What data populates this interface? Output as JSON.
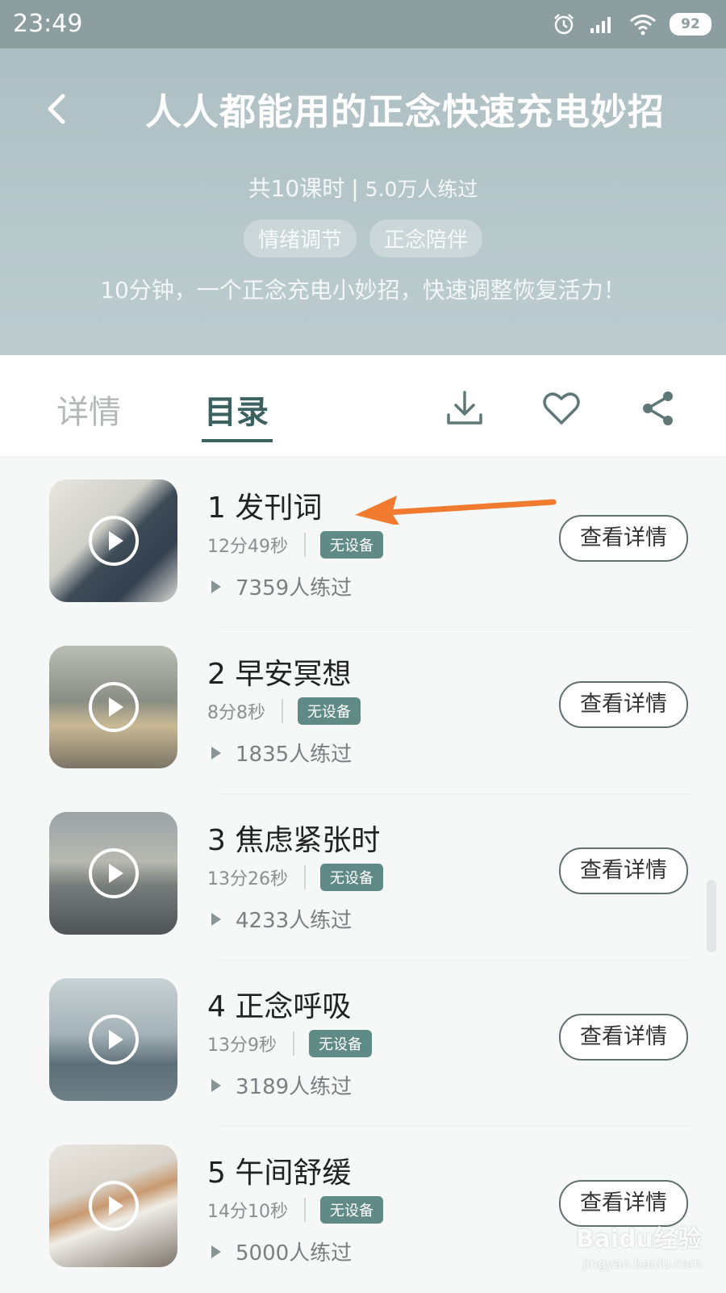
{
  "status_bar": {
    "time": "23:49",
    "battery": "92"
  },
  "header": {
    "title": "人人都能用的正念快速充电妙招",
    "lessons": "共10课时",
    "separator": "|",
    "practiced": "5.0万人练过",
    "tags": [
      "情绪调节",
      "正念陪伴"
    ],
    "description": "10分钟，一个正念充电小妙招，快速调整恢复活力！"
  },
  "tabs": {
    "detail": "详情",
    "catalog": "目录"
  },
  "lessons": [
    {
      "title": "1 发刊词",
      "duration": "12分49秒",
      "badge": "无设备",
      "plays": "7359人练过",
      "button": "查看详情"
    },
    {
      "title": "2 早安冥想",
      "duration": "8分8秒",
      "badge": "无设备",
      "plays": "1835人练过",
      "button": "查看详情"
    },
    {
      "title": "3 焦虑紧张时",
      "duration": "13分26秒",
      "badge": "无设备",
      "plays": "4233人练过",
      "button": "查看详情"
    },
    {
      "title": "4 正念呼吸",
      "duration": "13分9秒",
      "badge": "无设备",
      "plays": "3189人练过",
      "button": "查看详情"
    },
    {
      "title": "5 午间舒缓",
      "duration": "14分10秒",
      "badge": "无设备",
      "plays": "5000人练过",
      "button": "查看详情"
    }
  ],
  "colors": {
    "accent": "#3b6160",
    "badge": "#5f8a86",
    "annotation_arrow": "#f07a2e"
  },
  "watermark": {
    "text": "Baidu经验",
    "sub": "jingyan.baidu.com"
  }
}
